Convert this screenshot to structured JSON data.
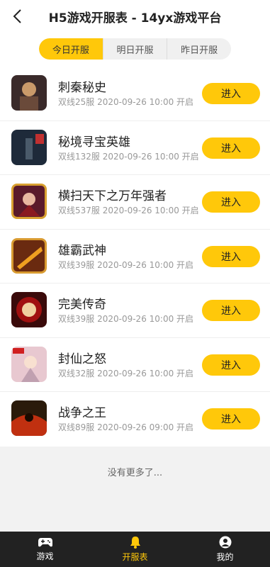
{
  "header": {
    "title": "H5游戏开服表 - 14yx游戏平台"
  },
  "tabs": [
    {
      "label": "今日开服",
      "active": true
    },
    {
      "label": "明日开服",
      "active": false
    },
    {
      "label": "昨日开服",
      "active": false
    }
  ],
  "games": [
    {
      "name": "刺秦秘史",
      "meta": "双线25服 2020-09-26 10:00 开启",
      "button": "进入",
      "icon_color": "#3a2a2a"
    },
    {
      "name": "秘境寻宝英雄",
      "meta": "双线132服 2020-09-26 10:00 开启",
      "button": "进入",
      "icon_color": "#1e2a3a"
    },
    {
      "name": "横扫天下之万年强者",
      "meta": "双线537服 2020-09-26 10:00 开启",
      "button": "进入",
      "icon_color": "#5a1a2a"
    },
    {
      "name": "雄霸武神",
      "meta": "双线39服 2020-09-26 10:00 开启",
      "button": "进入",
      "icon_color": "#6a2a10"
    },
    {
      "name": "完美传奇",
      "meta": "双线39服 2020-09-26 10:00 开启",
      "button": "进入",
      "icon_color": "#3a0a0a"
    },
    {
      "name": "封仙之怒",
      "meta": "双线32服 2020-09-26 10:00 开启",
      "button": "进入",
      "icon_color": "#e8c8d0"
    },
    {
      "name": "战争之王",
      "meta": "双线89服 2020-09-26 09:00 开启",
      "button": "进入",
      "icon_color": "#2a1a0a"
    }
  ],
  "footer_text": "没有更多了...",
  "nav": [
    {
      "label": "游戏",
      "icon": "gamepad-icon",
      "active": false
    },
    {
      "label": "开服表",
      "icon": "bell-icon",
      "active": true
    },
    {
      "label": "我的",
      "icon": "user-icon",
      "active": false
    }
  ],
  "colors": {
    "accent": "#ffc80a",
    "nav_bg": "#222222"
  }
}
